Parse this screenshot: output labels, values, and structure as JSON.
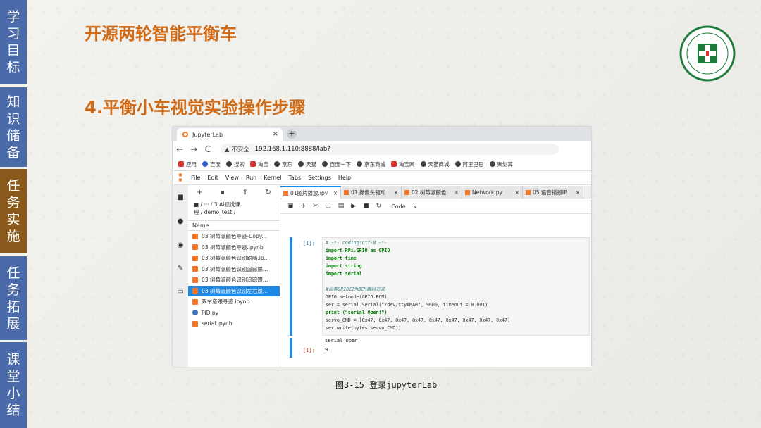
{
  "nav": [
    {
      "label": "学习目标",
      "chars": [
        "学",
        "习",
        "目",
        "标"
      ],
      "active": false
    },
    {
      "label": "知识储备",
      "chars": [
        "知",
        "识",
        "储",
        "备"
      ],
      "active": false
    },
    {
      "label": "任务实施",
      "chars": [
        "任",
        "务",
        "实",
        "施"
      ],
      "active": true
    },
    {
      "label": "任务拓展",
      "chars": [
        "任",
        "务",
        "拓",
        "展"
      ],
      "active": false
    },
    {
      "label": "课堂小结",
      "chars": [
        "课",
        "堂",
        "小",
        "结"
      ],
      "active": false
    }
  ],
  "slide": {
    "title": "开源两轮智能平衡车",
    "subtitle": "4.平衡小车视觉实验操作步骤",
    "caption": "图3-15 登录jupyterLab",
    "logo_text": "CHEN DU COLLEGE",
    "logo_year": "2020",
    "logo_name": "成都学院"
  },
  "colors": {
    "nav": "#4a6aa9",
    "nav_active": "#8a5a1c",
    "title": "#d06a16",
    "jupyter": "#f37726",
    "selection": "#1e88e5"
  },
  "browser": {
    "tab_title": "JupyterLab",
    "tab_close": "×",
    "new_tab": "+",
    "back": "←",
    "forward": "→",
    "reload": "C",
    "security": "▲ 不安全",
    "url": "192.168.1.110:8888/lab?",
    "bookmarks": [
      "应用",
      "百度",
      "搜索",
      "淘宝",
      "京东",
      "天猫",
      "百度一下",
      "京东商城",
      "淘宝网",
      "天猫商城",
      "阿里巴巴",
      "聚划算"
    ]
  },
  "jupyter": {
    "menu": [
      "File",
      "Edit",
      "View",
      "Run",
      "Kernel",
      "Tabs",
      "Settings",
      "Help"
    ],
    "breadcrumb_1": "■ / ··· / 3.AI视觉课",
    "breadcrumb_2": "程 / demo_test /",
    "column_name": "Name",
    "files": [
      {
        "name": "03.树莓派颜色寻迹-Copy...",
        "type": "nb",
        "selected": false
      },
      {
        "name": "03.树莓派颜色寻迹.ipynb",
        "type": "nb",
        "selected": false
      },
      {
        "name": "03.树莓派颜色识别跟随.ip...",
        "type": "nb",
        "selected": false
      },
      {
        "name": "03.树莓派颜色识别追踪跟...",
        "type": "nb",
        "selected": false
      },
      {
        "name": "03.树莓派颜色识别追踪跟...",
        "type": "nb",
        "selected": false
      },
      {
        "name": "03.树莓派颜色识别左右跟...",
        "type": "nb",
        "selected": true
      },
      {
        "name": "双车道跟寻迹.ipynb",
        "type": "nb",
        "selected": false
      },
      {
        "name": "PID.py",
        "type": "py",
        "selected": false
      },
      {
        "name": "serial.ipynb",
        "type": "nb",
        "selected": false
      }
    ],
    "doc_tabs": [
      {
        "label": "01图片播放.ipy",
        "active": true
      },
      {
        "label": "01.摄像头驱动",
        "active": false
      },
      {
        "label": "02.树莓派颜色",
        "active": false
      },
      {
        "label": "Network.py",
        "active": false
      },
      {
        "label": "05.语音播报IP",
        "active": false
      }
    ],
    "kernel_select": "Code",
    "prompt_in": "[1]:",
    "prompt_out": "[1]:",
    "code_lines": [
      {
        "cls": "cm",
        "text": "# -*- coding:utf-8 -*-"
      },
      {
        "cls": "kw",
        "text": "import RPi.GPIO as GPIO"
      },
      {
        "cls": "kw",
        "text": "import time"
      },
      {
        "cls": "kw",
        "text": "import string"
      },
      {
        "cls": "kw",
        "text": "import serial"
      },
      {
        "cls": "",
        "text": ""
      },
      {
        "cls": "cm",
        "text": "#设置GPIO口为BCM编码方式"
      },
      {
        "cls": "",
        "text": "GPIO.setmode(GPIO.BCM)"
      },
      {
        "cls": "",
        "text": "ser = serial.Serial(\"/dev/ttyAMA0\", 9600, timeout = 0.001)"
      },
      {
        "cls": "kw",
        "text": "print (\"serial Open!\")"
      },
      {
        "cls": "",
        "text": "servo_CMD = [0x47, 0x47, 0x47, 0x47, 0x47, 0x47, 0x47, 0x47, 0x47]"
      },
      {
        "cls": "",
        "text": "ser.write(bytes(servo_CMD))"
      }
    ],
    "output_text": "serial Open!",
    "output_value": "9"
  }
}
